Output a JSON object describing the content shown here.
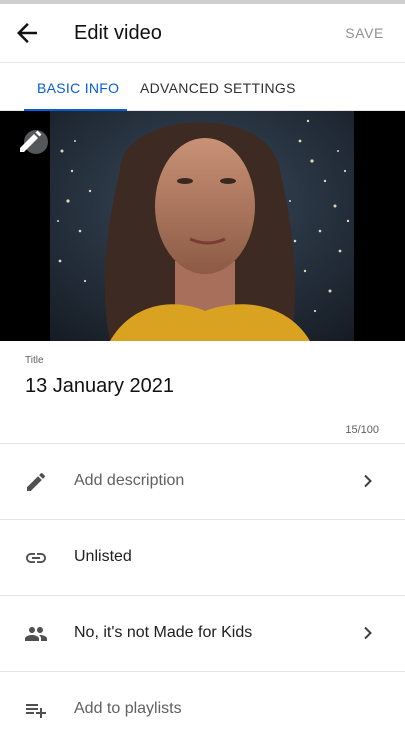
{
  "header": {
    "title": "Edit video",
    "save_label": "SAVE",
    "back_icon": "arrow-left-icon"
  },
  "tabs": [
    {
      "label": "BASIC INFO",
      "active": true
    },
    {
      "label": "ADVANCED SETTINGS",
      "active": false
    }
  ],
  "thumbnail": {
    "edit_icon": "pencil-icon"
  },
  "title_field": {
    "label": "Title",
    "value": "13 January 2021",
    "counter": "15/100"
  },
  "rows": [
    {
      "label": "Add description",
      "icon": "pencil-icon",
      "has_chevron": true
    },
    {
      "label": "Unlisted",
      "icon": "link-icon",
      "has_chevron": false
    },
    {
      "label": "No, it's not Made for Kids",
      "icon": "people-icon",
      "has_chevron": true
    },
    {
      "label": "Add to playlists",
      "icon": "playlist-add-icon",
      "has_chevron": false
    }
  ],
  "colors": {
    "accent": "#065fd4",
    "muted_text": "#606060",
    "divider": "#e3e3e3"
  }
}
